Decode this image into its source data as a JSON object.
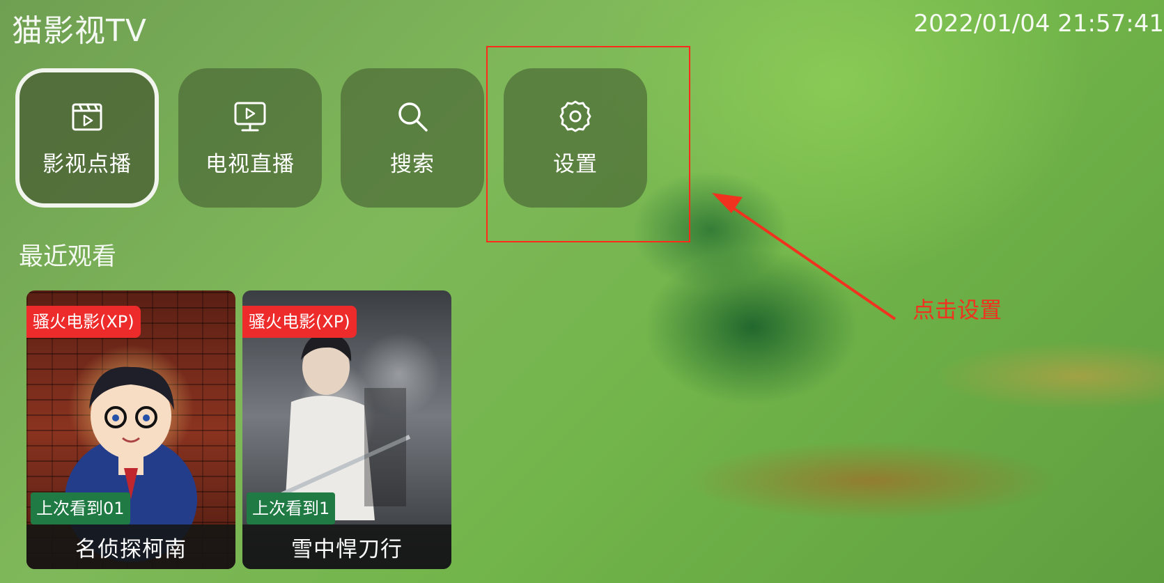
{
  "header": {
    "app_title": "猫影视TV",
    "clock": "2022/01/04 21:57:41"
  },
  "menu": {
    "items": [
      {
        "label": "影视点播",
        "icon": "video-clapper-icon",
        "focused": true
      },
      {
        "label": "电视直播",
        "icon": "tv-play-icon",
        "focused": false
      },
      {
        "label": "搜索",
        "icon": "search-icon",
        "focused": false
      },
      {
        "label": "设置",
        "icon": "gear-icon",
        "focused": false
      }
    ]
  },
  "recent": {
    "title": "最近观看",
    "cards": [
      {
        "source": "骚火电影(XP)",
        "progress": "上次看到01",
        "title": "名侦探柯南"
      },
      {
        "source": "骚火电影(XP)",
        "progress": "上次看到1",
        "title": "雪中悍刀行"
      }
    ]
  },
  "annotation": {
    "text": "点击设置",
    "color": "#ff2a1a"
  }
}
